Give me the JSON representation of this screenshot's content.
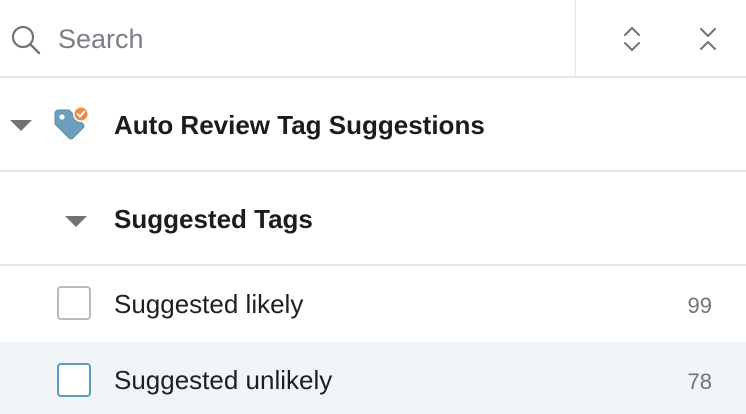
{
  "search": {
    "placeholder": "Search",
    "value": ""
  },
  "toolbar": {
    "expand_all_icon": "chevrons-expand-icon",
    "collapse_all_icon": "chevrons-collapse-icon"
  },
  "tree": {
    "group": {
      "label": "Auto Review Tag Suggestions",
      "icon": "tag-check-icon",
      "expanded": true,
      "colors": {
        "tag": "#6c9fbd",
        "badge": "#f08a4b"
      }
    },
    "subgroup": {
      "label": "Suggested Tags",
      "expanded": true
    },
    "items": [
      {
        "label": "Suggested likely",
        "count": "99",
        "checked": false
      },
      {
        "label": "Suggested unlikely",
        "count": "78",
        "checked": false,
        "highlighted": true
      }
    ]
  },
  "colors": {
    "divider": "#e3e5e7",
    "highlight_row": "#f1f5f8",
    "checkbox_focus": "#5c9fbd"
  }
}
